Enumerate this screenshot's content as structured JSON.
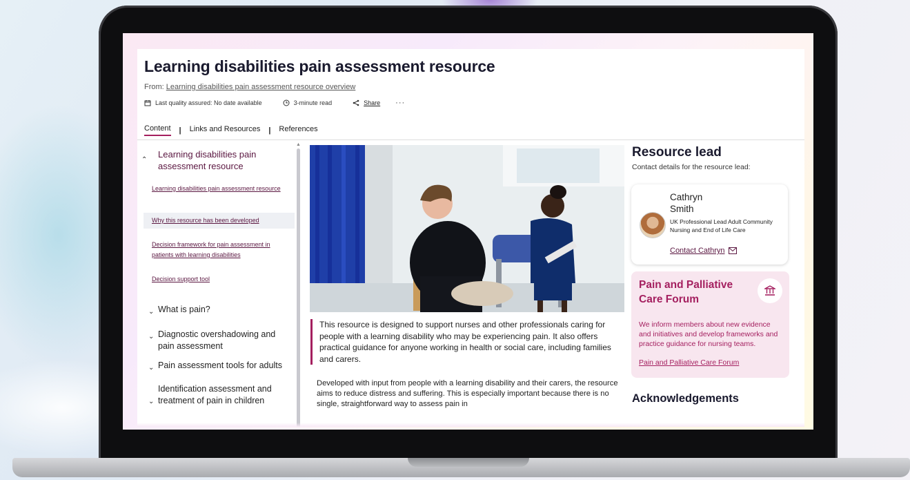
{
  "page": {
    "title": "Learning disabilities pain assessment resource",
    "from_prefix": "From: ",
    "from_link": "Learning disabilities pain assessment resource overview",
    "meta": {
      "quality": "Last quality assured: No date available",
      "read_time": "3-minute read",
      "share": "Share",
      "more": "···"
    },
    "tabs": [
      {
        "label": "Content",
        "active": true
      },
      {
        "label": "Links and Resources",
        "active": false
      },
      {
        "label": "References",
        "active": false
      }
    ],
    "tab_separator": "|"
  },
  "nav": {
    "heading": "Learning disabilities pain assessment resource",
    "sub_items": [
      {
        "label": "Learning disabilities pain assessment resource",
        "highlighted": false
      },
      {
        "label": "Why this resource has been developed",
        "highlighted": true
      },
      {
        "label": "Decision framework for pain assessment in patients with learning disabilities",
        "highlighted": false
      },
      {
        "label": "Decision support tool",
        "highlighted": false
      }
    ],
    "sections": [
      "What is pain?",
      "Diagnostic overshadowing and pain assessment",
      "Pain assessment tools for adults",
      "Identification assessment and treatment of pain in children"
    ]
  },
  "main": {
    "intro": "This resource is designed to support nurses and other professionals caring for people with a learning disability who may be experiencing pain. It also offers practical guidance for anyone working in health or social care, including families and carers.",
    "body": "Developed with input from people with a learning disability and their carers, the resource aims to reduce distress and suffering. This is especially important because there is no single, straightforward way to assess pain in"
  },
  "sidebar": {
    "resource_lead_title": "Resource lead",
    "resource_lead_sub": "Contact details for the resource lead:",
    "contact": {
      "name": "Cathryn Smith",
      "role": "UK Professional Lead Adult Community Nursing and End of Life Care",
      "contact_link": "Contact Cathryn"
    },
    "forum": {
      "title": "Pain and Palliative Care Forum",
      "text": "We inform members about new evidence and initiatives and develop frameworks and practice guidance for nursing teams.",
      "link": "Pain and Palliative Care Forum"
    },
    "acknowledgements": "Acknowledgements"
  },
  "colors": {
    "accent": "#a41f5f",
    "nav_link": "#5a1640",
    "heading": "#1a1a2e",
    "forum_bg": "#f8e6ef"
  }
}
